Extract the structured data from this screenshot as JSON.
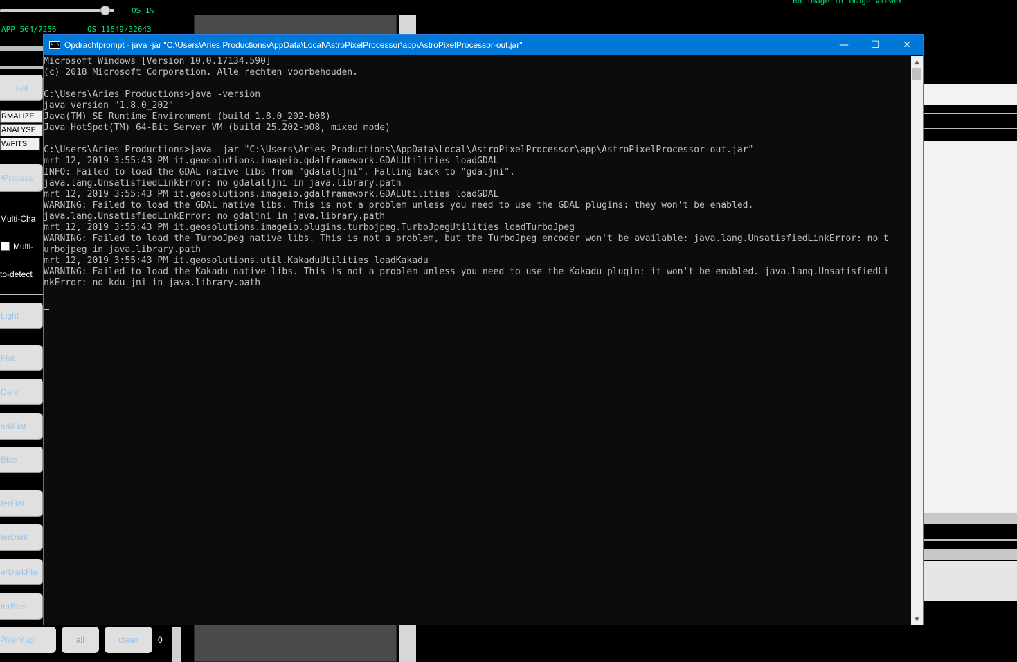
{
  "background_app": {
    "os_percent": "OS 1%",
    "app_memory": "APP 564/7256",
    "os_memory": "OS 11649/32643",
    "viewer_message": "no image in image viewer",
    "set_label": "set",
    "normalize_label": "RMALIZE",
    "analyse_label": "ANALYSE",
    "fits_label": "W/FITS",
    "process_label": "/Process",
    "multi_channel_label": "Multi-Cha",
    "multi_checkbox_label": "Multi-",
    "auto_detect_label": "to-detect",
    "frame_buttons": [
      "Light",
      "Flat",
      "Dark",
      "arkFlat",
      "Bias",
      "terFlat",
      "terDark",
      "erDarkFla",
      "terBias"
    ],
    "pixelmap_label": "PixelMap",
    "all_label": "all",
    "clean_label": "clean",
    "count_value": "0",
    "text_color": "#00e676",
    "button_text_color": "#9fc4e8"
  },
  "cmd_window": {
    "title": "Opdrachtprompt - java  -jar \"C:\\Users\\Aries Productions\\AppData\\Local\\AstroPixelProcessor\\app\\AstroPixelProcessor-out.jar\"",
    "icon_text": "C:\\",
    "minimize_glyph": "—",
    "maximize_glyph": "☐",
    "close_glyph": "✕",
    "scroll_up_glyph": "▲",
    "scroll_down_glyph": "▼",
    "title_bar_color": "#0078d7",
    "lines": [
      "Microsoft Windows [Version 10.0.17134.590]",
      "(c) 2018 Microsoft Corporation. Alle rechten voorbehouden.",
      "",
      "C:\\Users\\Aries Productions>java -version",
      "java version \"1.8.0_202\"",
      "Java(TM) SE Runtime Environment (build 1.8.0_202-b08)",
      "Java HotSpot(TM) 64-Bit Server VM (build 25.202-b08, mixed mode)",
      "",
      "C:\\Users\\Aries Productions>java -jar \"C:\\Users\\Aries Productions\\AppData\\Local\\AstroPixelProcessor\\app\\AstroPixelProcessor-out.jar\"",
      "mrt 12, 2019 3:55:43 PM it.geosolutions.imageio.gdalframework.GDALUtilities loadGDAL",
      "INFO: Failed to load the GDAL native libs from \"gdalalljni\". Falling back to \"gdaljni\".",
      "java.lang.UnsatisfiedLinkError: no gdalalljni in java.library.path",
      "mrt 12, 2019 3:55:43 PM it.geosolutions.imageio.gdalframework.GDALUtilities loadGDAL",
      "WARNING: Failed to load the GDAL native libs. This is not a problem unless you need to use the GDAL plugins: they won't be enabled.",
      "java.lang.UnsatisfiedLinkError: no gdaljni in java.library.path",
      "mrt 12, 2019 3:55:43 PM it.geosolutions.imageio.plugins.turbojpeg.TurboJpegUtilities loadTurboJpeg",
      "WARNING: Failed to load the TurboJpeg native libs. This is not a problem, but the TurboJpeg encoder won't be available: java.lang.UnsatisfiedLinkError: no t",
      "urbojpeg in java.library.path",
      "mrt 12, 2019 3:55:43 PM it.geosolutions.util.KakaduUtilities loadKakadu",
      "WARNING: Failed to load the Kakadu native libs. This is not a problem unless you need to use the Kakadu plugin: it won't be enabled. java.lang.UnsatisfiedLi",
      "nkError: no kdu_jni in java.library.path",
      ""
    ]
  }
}
